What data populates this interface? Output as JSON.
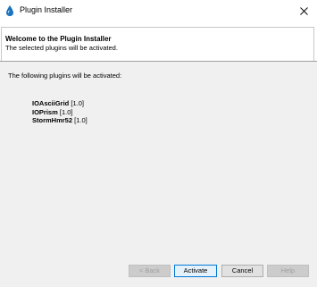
{
  "window": {
    "title": "Plugin Installer",
    "title_icon": "blue-drop-icon",
    "close_icon": "close-icon"
  },
  "header": {
    "title": "Welcome to the Plugin Installer",
    "subtitle": "The selected plugins will be activated."
  },
  "content": {
    "intro": "The following plugins will be activated:",
    "plugins": [
      {
        "name": "IOAsciiGrid",
        "version": "[1.0]"
      },
      {
        "name": "IOPrism",
        "version": "[1.0]"
      },
      {
        "name": "StormHmr52",
        "version": "[1.0]"
      }
    ]
  },
  "buttons": {
    "back": "< Back",
    "activate": "Activate",
    "cancel": "Cancel",
    "help": "Help"
  },
  "colors": {
    "accent": "#0078d7",
    "icon_blue": "#1e73be",
    "content_bg": "#f0f0f0"
  }
}
